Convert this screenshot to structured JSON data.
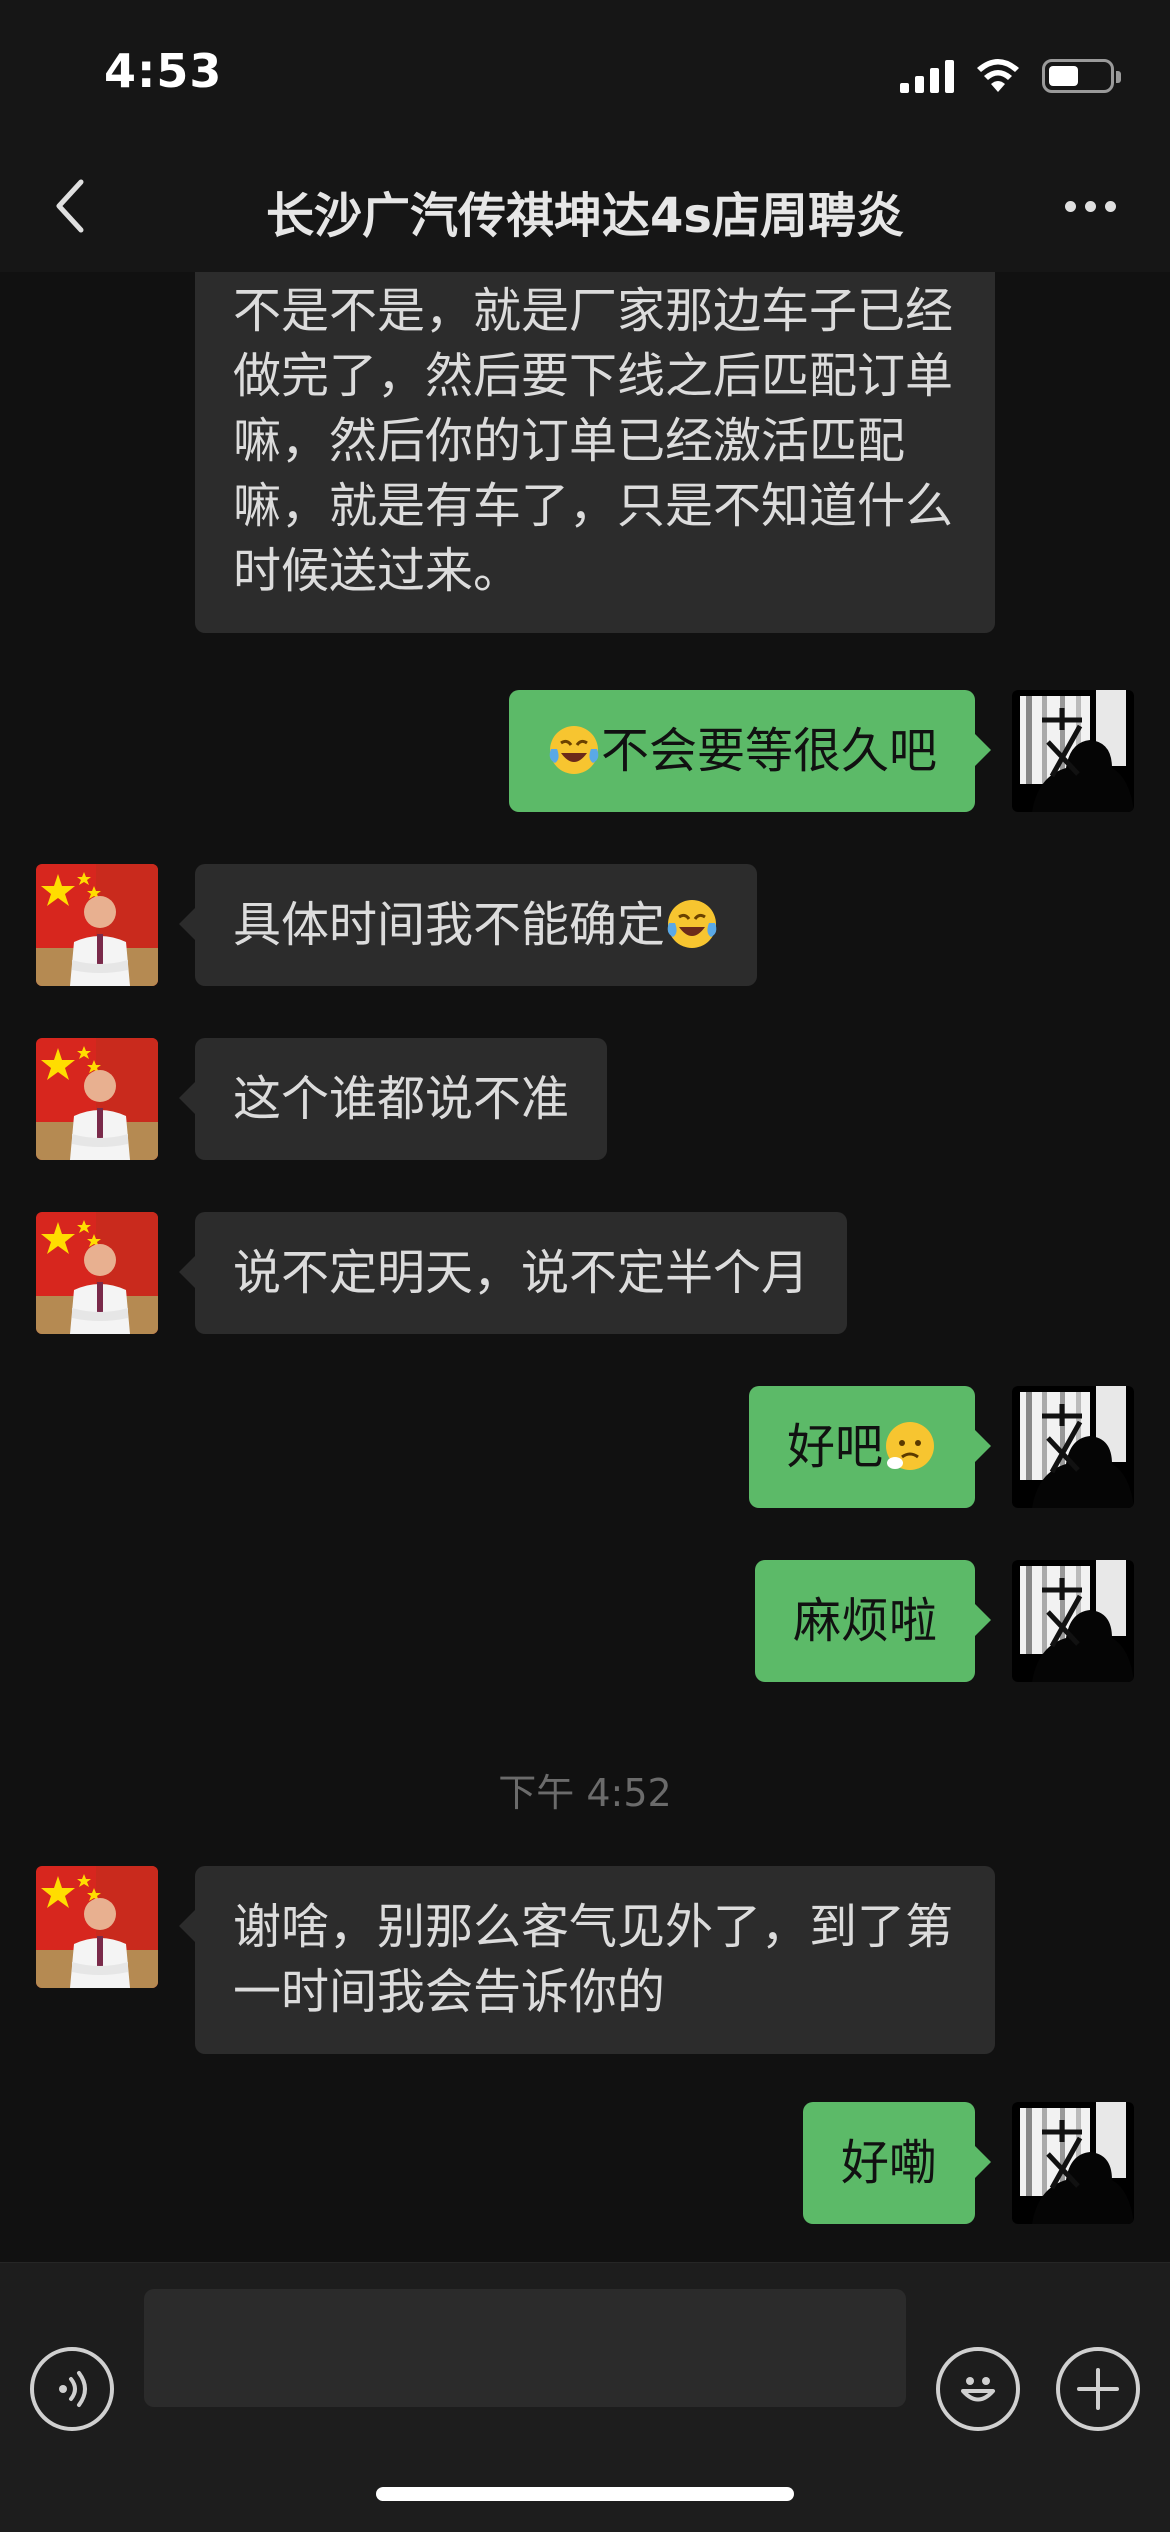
{
  "status_bar": {
    "time": "4:53"
  },
  "header": {
    "title": "长沙广汽传祺坤达4s店周聘炎"
  },
  "messages": [
    {
      "side": "in",
      "text": "不是不是，就是厂家那边车子已经做完了，然后要下线之后匹配订单嘛，然后你的订单已经激活匹配嘛，就是有车了，只是不知道什么时候送过来。"
    },
    {
      "side": "out",
      "emoji": "face-with-tears-of-joy-emoji",
      "text": "不会要等很久吧"
    },
    {
      "side": "in",
      "text": "具体时间我不能确定",
      "emoji": "face-with-tears-of-joy-emoji"
    },
    {
      "side": "in",
      "text": "这个谁都说不准"
    },
    {
      "side": "in",
      "text": "说不定明天，说不定半个月"
    },
    {
      "side": "out",
      "text": "好吧",
      "emoji": "sad-face-emoji"
    },
    {
      "side": "out",
      "text": "麻烦啦"
    },
    {
      "side": "time",
      "text": "下午 4:52"
    },
    {
      "side": "in",
      "text": "谢啥，别那么客气见外了，到了第一时间我会告诉你的"
    },
    {
      "side": "out",
      "text": "好嘞"
    }
  ],
  "input": {
    "value": ""
  },
  "colors": {
    "background": "#111111",
    "incoming_bubble": "#2c2c2c",
    "outgoing_bubble": "#5cba68",
    "timestamp": "#6b6b6b"
  },
  "icons": {
    "back": "chevron-left-icon",
    "more": "more-dots-icon",
    "voice": "voice-icon",
    "emoji": "emoji-icon",
    "plus": "plus-icon"
  }
}
